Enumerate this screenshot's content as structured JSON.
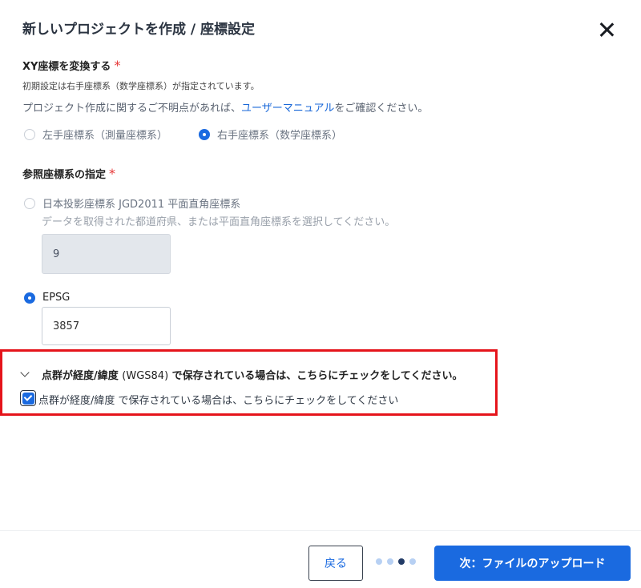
{
  "header": {
    "title": "新しいプロジェクトを作成 / 座標設定"
  },
  "xy_section": {
    "label": "XY座標を変換する",
    "required_mark": "*",
    "note": "初期設定は右手座標系（数学座標系）が指定されています。",
    "help_prefix": "プロジェクト作成に関するご不明点があれば、",
    "help_link": "ユーザーマニュアル",
    "help_suffix": "をご確認ください。",
    "options": [
      {
        "label": "左手座標系（測量座標系）",
        "selected": false
      },
      {
        "label": "右手座標系（数学座標系）",
        "selected": true
      }
    ]
  },
  "crs_section": {
    "label": "参照座標系の指定",
    "required_mark": "*",
    "jgd": {
      "label": "日本投影座標系 JGD2011 平面直角座標系",
      "selected": false,
      "help": "データを取得された都道府県、または平面直角座標系を選択してください。",
      "value": "9"
    },
    "epsg": {
      "label": "EPSG",
      "selected": true,
      "value": "3857"
    }
  },
  "latlon_section": {
    "title_a": "点群が経度/緯度 ",
    "title_b": "(WGS84)",
    "title_c": " で保存されている場合は、こちらにチェックをしてください。",
    "checkbox_label": "点群が経度/緯度 で保存されている場合は、こちらにチェックをしてください",
    "checked": true
  },
  "footer": {
    "back_label": "戻る",
    "next_label": "次：ファイルのアップロード",
    "steps_total": 4,
    "step_current": 3
  },
  "colors": {
    "primary": "#1a6ae0",
    "required": "#e63535",
    "highlight": "#e5141b"
  }
}
